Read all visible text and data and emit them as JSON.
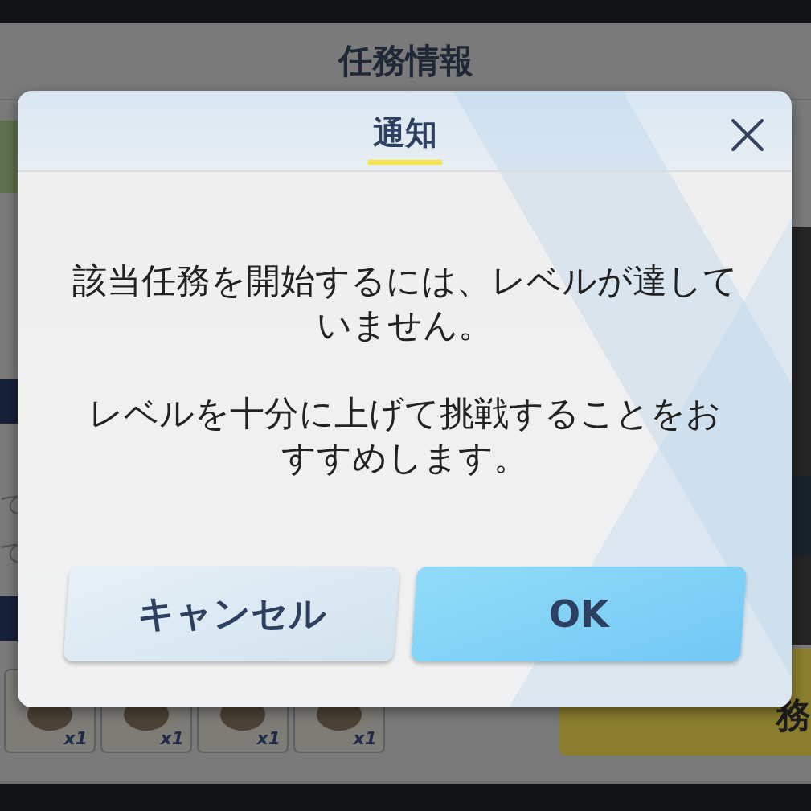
{
  "background": {
    "title": "任務情報",
    "left_texts": [
      {
        "kind": "tab"
      },
      {
        "kind": "bar"
      },
      {
        "kind": "gap"
      },
      {
        "kind": "line",
        "text": "て"
      },
      {
        "kind": "line",
        "text": "て"
      },
      {
        "kind": "bar"
      }
    ],
    "reward_items": [
      {
        "count": "x1"
      },
      {
        "count": "x1"
      },
      {
        "count": "x1"
      },
      {
        "count": "x1"
      }
    ],
    "action_button": "務"
  },
  "dialog": {
    "title": "通知",
    "message": [
      "該当任務を開始するには、レベルが達していません。",
      "レベルを十分に上げて挑戦することをおすすめします。"
    ],
    "buttons": [
      {
        "kind": "secondary",
        "label": "キャンセル"
      },
      {
        "kind": "primary",
        "label": "OK"
      }
    ]
  }
}
